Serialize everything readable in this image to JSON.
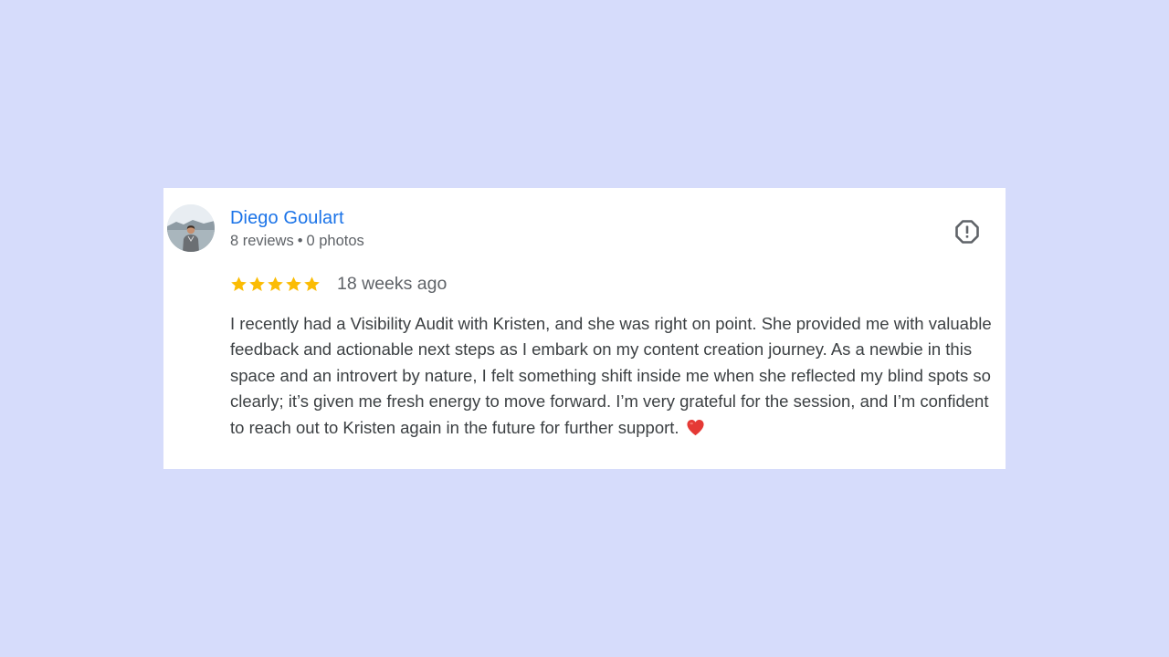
{
  "review": {
    "author": {
      "name": "Diego Goulart",
      "reviews_count": "8 reviews",
      "separator": "•",
      "photos_count": "0 photos",
      "avatar_icon": "profile-photo"
    },
    "rating": {
      "stars": 5,
      "max": 5,
      "star_color": "#fbbc04"
    },
    "date": "18 weeks ago",
    "text": "I recently had a Visibility Audit with Kristen, and she was right on point. She provided me with valuable feedback and actionable next steps as I embark on my content creation journey. As a newbie in this space and an introvert by nature, I felt something shift inside me when she reflected my blind spots so clearly; it’s given me fresh energy to move forward. I’m very grateful for the session, and I’m confident to reach out to Kristen again in the future for further support.",
    "trailing_emoji": "heart-icon",
    "report_icon": "report-icon"
  },
  "colors": {
    "background": "#d6dcfb",
    "card": "#ffffff",
    "link": "#1a73e8",
    "muted": "#5f6368",
    "body_text": "#3c4043",
    "heart": "#e53935"
  }
}
